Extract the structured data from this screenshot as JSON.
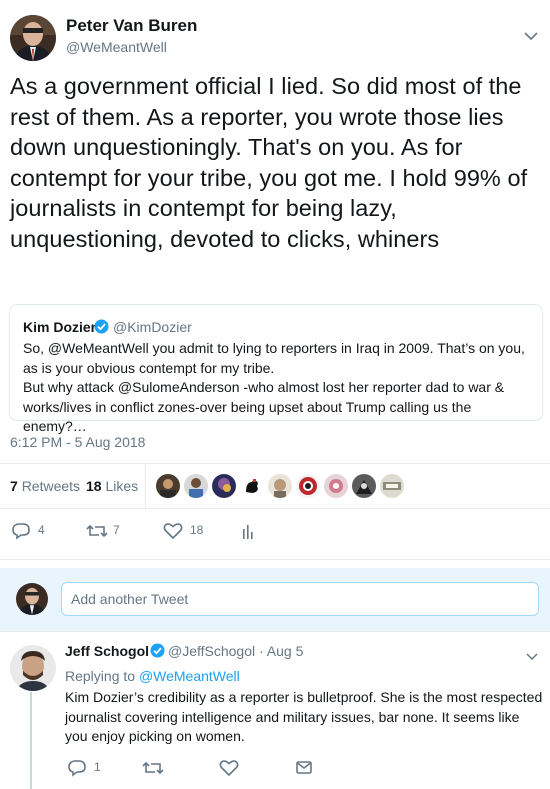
{
  "main_tweet": {
    "author_name": "Peter Van Buren",
    "author_handle": "@WeMeantWell",
    "text": "As a government official I lied. So did most of the rest of them. As a reporter, you wrote those lies down unquestioningly. That's on you. As for contempt for your tribe, you got me. I hold 99% of journalists in contempt for being lazy, unquestioning, devoted to clicks, whiners",
    "quoted": {
      "author_name": "Kim Dozier",
      "author_handle": "@KimDozier",
      "verified": true,
      "text_line1": "So, @WeMeantWell you admit to lying to reporters in Iraq in 2009. That’s on you, as is your obvious contempt for my tribe.",
      "text_line2": "But why attack @SulomeAnderson -who almost lost her reporter dad to war & works/lives in conflict zones-over being upset about Trump calling us the enemy?…"
    },
    "timestamp": "6:12 PM - 5 Aug 2018",
    "stats": {
      "retweets_count": "7",
      "retweets_label": "Retweets",
      "likes_count": "18",
      "likes_label": "Likes"
    },
    "actions": {
      "reply_count": "4",
      "retweet_count": "7",
      "like_count": "18"
    }
  },
  "reply_composer": {
    "placeholder": "Add another Tweet"
  },
  "reply_tweet": {
    "author_name": "Jeff Schogol",
    "author_handle": "@JeffSchogol · Aug 5",
    "verified": true,
    "replying_prefix": "Replying to",
    "replying_to": "@WeMeantWell",
    "text": "Kim Dozier’s credibility as a reporter is bulletproof. She is the most respected journalist covering intelligence and military issues, bar none. It seems like you enjoy picking on women.",
    "actions": {
      "reply_count": "1"
    }
  },
  "colors": {
    "accent": "#1da1f2",
    "secondary_text": "#657786",
    "border": "#e6ecf0",
    "composer_bg": "#e8f5fd"
  }
}
